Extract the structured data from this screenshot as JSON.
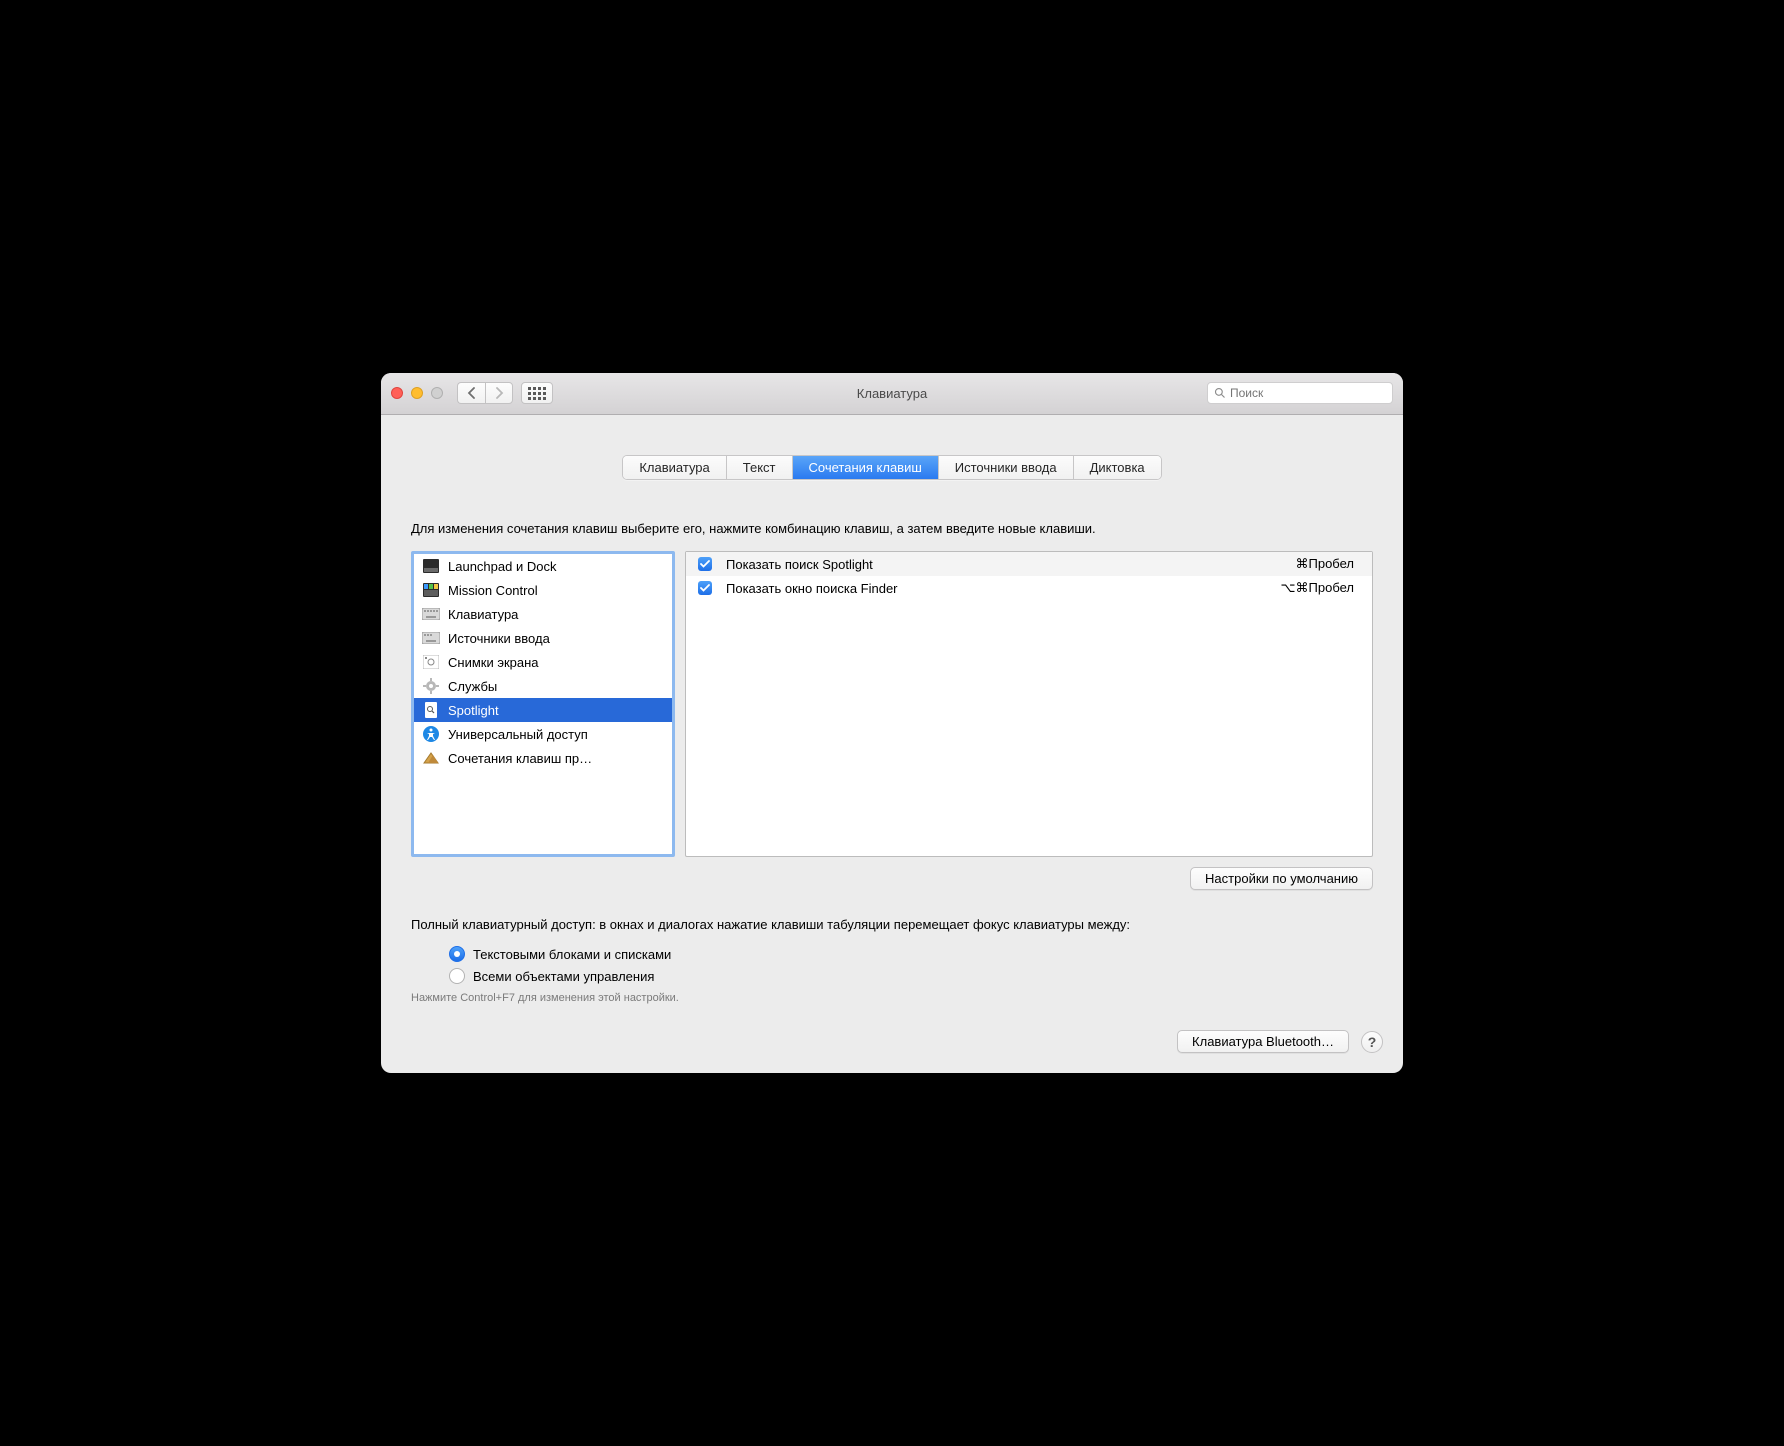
{
  "window": {
    "title": "Клавиатура"
  },
  "search": {
    "placeholder": "Поиск"
  },
  "tabs": [
    "Клавиатура",
    "Текст",
    "Сочетания клавиш",
    "Источники ввода",
    "Диктовка"
  ],
  "active_tab": 2,
  "instruction": "Для изменения сочетания клавиш выберите его, нажмите комбинацию клавиш, а затем введите новые клавиши.",
  "sidebar": {
    "items": [
      {
        "label": "Launchpad и Dock"
      },
      {
        "label": "Mission Control"
      },
      {
        "label": "Клавиатура"
      },
      {
        "label": "Источники ввода"
      },
      {
        "label": "Снимки экрана"
      },
      {
        "label": "Службы"
      },
      {
        "label": "Spotlight"
      },
      {
        "label": "Универсальный доступ"
      },
      {
        "label": "Сочетания клавиш пр…"
      }
    ],
    "selected": 6
  },
  "shortcuts": [
    {
      "enabled": true,
      "label": "Показать поиск Spotlight",
      "keys": "⌘Пробел"
    },
    {
      "enabled": true,
      "label": "Показать окно поиска Finder",
      "keys": "⌥⌘Пробел"
    }
  ],
  "buttons": {
    "restore_defaults": "Настройки по умолчанию",
    "bluetooth": "Клавиатура Bluetooth…"
  },
  "full_access": {
    "text": "Полный клавиатурный доступ: в окнах и диалогах нажатие клавиши табуляции перемещает фокус клавиатуры между:",
    "options": [
      "Текстовыми блоками и списками",
      "Всеми объектами управления"
    ],
    "selected": 0,
    "hint": "Нажмите Control+F7 для изменения этой настройки."
  },
  "help": "?"
}
